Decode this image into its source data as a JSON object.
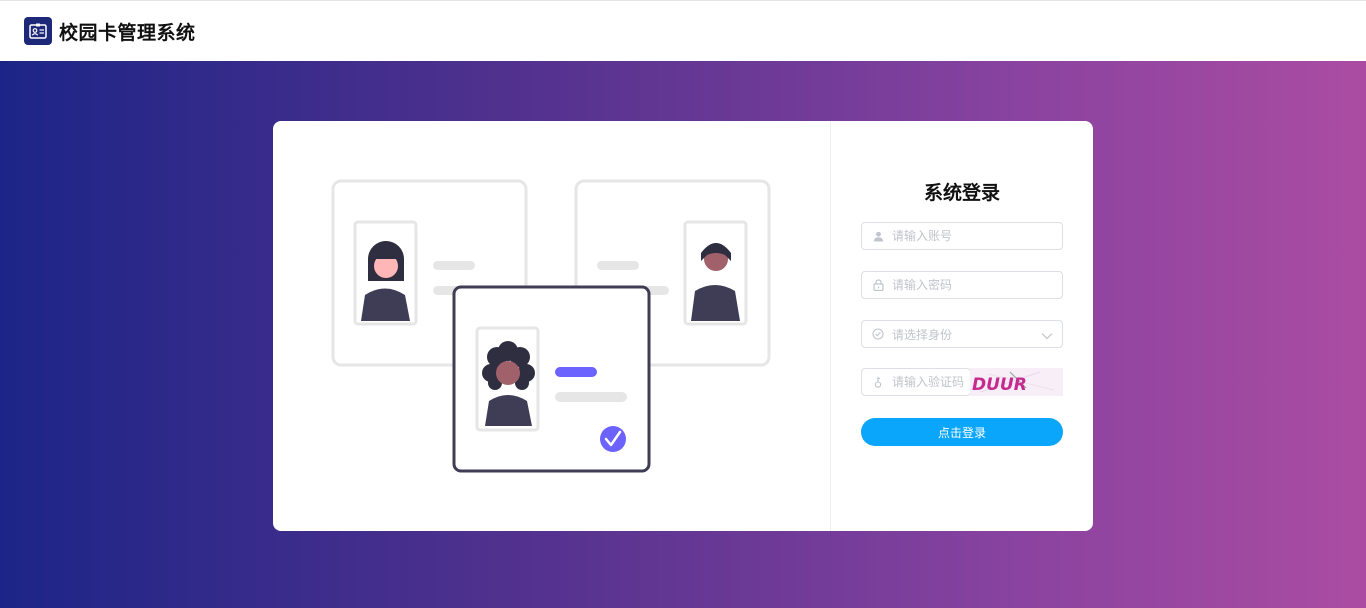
{
  "app": {
    "title": "校园卡管理系统",
    "logo_icon": "id-card-icon"
  },
  "login": {
    "title": "系统登录",
    "account": {
      "placeholder": "请输入账号",
      "icon": "user-icon"
    },
    "password": {
      "placeholder": "请输入密码",
      "icon": "lock-icon"
    },
    "role": {
      "placeholder": "请选择身份",
      "icon": "check-circle-icon"
    },
    "captcha": {
      "placeholder": "请输入验证码",
      "icon": "key-icon",
      "code": "DUUR"
    },
    "submit_label": "点击登录"
  },
  "colors": {
    "accent": "#0aa6fb",
    "gradient_start": "#1c2587",
    "gradient_end": "#ab4ca2",
    "header_logo": "#1e2878"
  }
}
